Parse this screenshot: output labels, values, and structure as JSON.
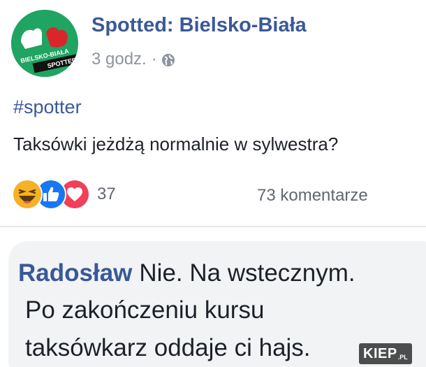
{
  "post": {
    "page_name": "Spotted: Bielsko-Biała",
    "timestamp": "3 godz.",
    "separator": "·",
    "privacy_icon": "globe-icon",
    "avatar": {
      "icon": "spotted-logo",
      "text_line1": "BIELSKO-BIAŁA",
      "text_line2": "SPOTTED",
      "colors": {
        "background": "#1fa461",
        "accent": "#d9262b"
      }
    },
    "hashtag": "#spotter",
    "text": "Taksówki jeżdżą normalnie w sylwestra?",
    "reactions": {
      "icons": [
        "haha-icon",
        "like-icon",
        "love-icon"
      ],
      "count": "37",
      "comments": "73 komentarze"
    }
  },
  "comment": {
    "author": "Radosław",
    "line1": "Nie. Na wstecznym.",
    "line2": "Po zakończeniu kursu",
    "line3": "taksówkarz oddaje ci hajs."
  },
  "watermark": {
    "text": "KIEP",
    "suffix": ".PL"
  },
  "colors": {
    "link": "#3b5998",
    "text": "#1d2129",
    "muted": "#606770",
    "like": "#1877f2",
    "love": "#f33e58",
    "haha": "#f7b125"
  }
}
